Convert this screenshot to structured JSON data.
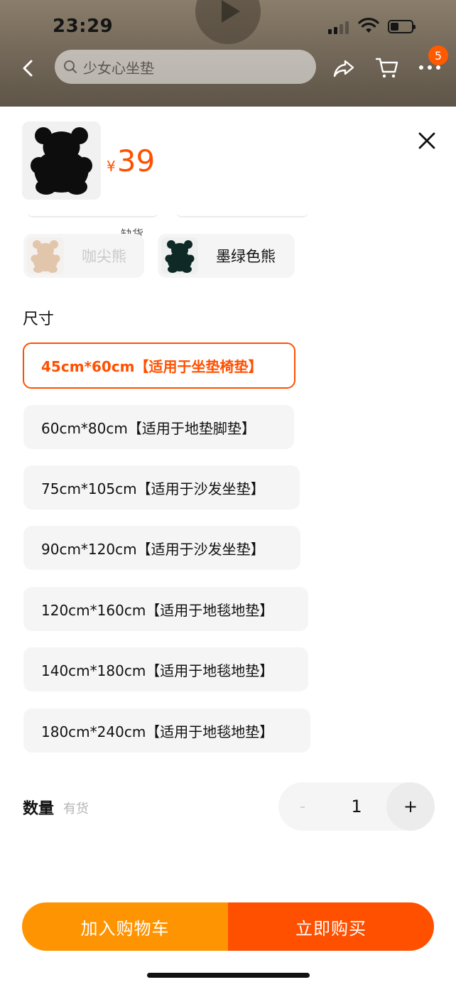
{
  "status_bar": {
    "time": "23:29"
  },
  "nav": {
    "search_placeholder": "少女心坐垫",
    "cart_badge": "5"
  },
  "product": {
    "currency": "¥",
    "price": "39"
  },
  "colors": {
    "out_of_stock_label": "缺货",
    "options": [
      {
        "label": "咖尖熊",
        "available": false
      },
      {
        "label": "墨绿色熊",
        "available": true
      }
    ]
  },
  "size": {
    "title": "尺寸",
    "options": [
      {
        "label": "45cm*60cm【适用于坐垫椅垫】",
        "selected": true
      },
      {
        "label": "60cm*80cm【适用于地垫脚垫】",
        "selected": false
      },
      {
        "label": "75cm*105cm【适用于沙发坐垫】",
        "selected": false
      },
      {
        "label": "90cm*120cm【适用于沙发坐垫】",
        "selected": false
      },
      {
        "label": "120cm*160cm【适用于地毯地垫】",
        "selected": false
      },
      {
        "label": "140cm*180cm【适用于地毯地垫】",
        "selected": false
      },
      {
        "label": "180cm*240cm【适用于地毯地垫】",
        "selected": false
      }
    ]
  },
  "quantity": {
    "label": "数量",
    "stock_status": "有货",
    "value": "1",
    "minus": "-",
    "plus": "+"
  },
  "actions": {
    "add_to_cart": "加入购物车",
    "buy_now": "立即购买"
  },
  "theme": {
    "accent": "#ff5000",
    "cart_button": "#ff9402"
  }
}
